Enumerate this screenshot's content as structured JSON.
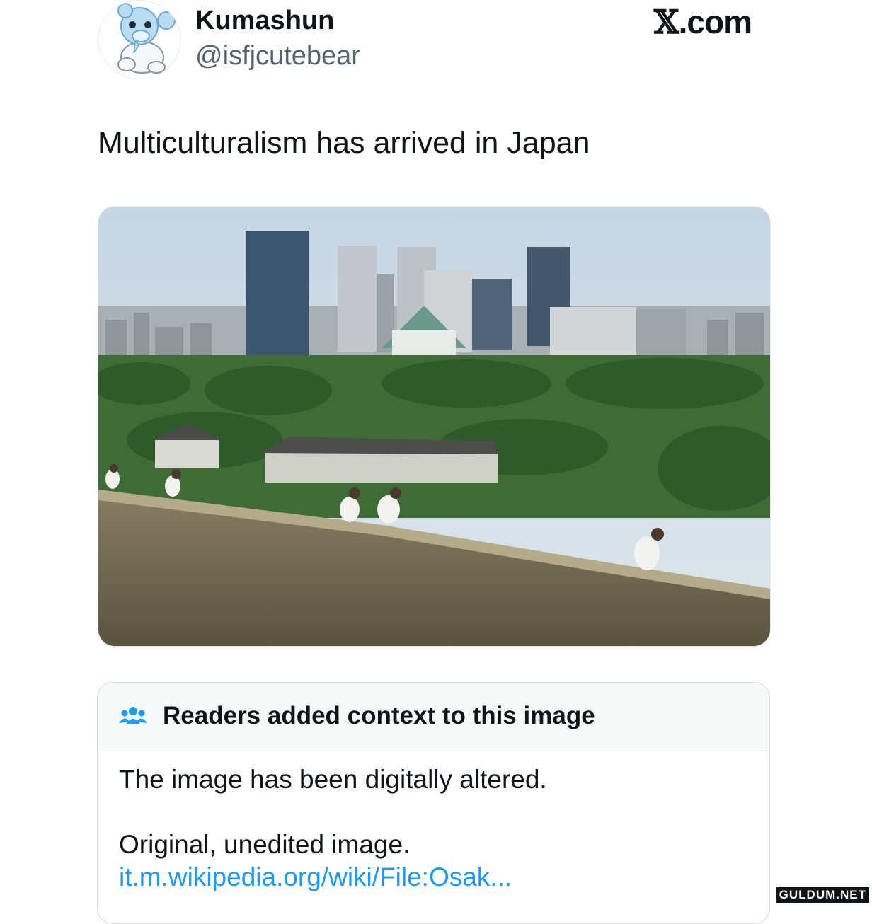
{
  "post": {
    "display_name": "Kumashun",
    "handle": "@isfjcutebear",
    "text": "Multiculturalism has arrived in Japan",
    "avatar_icon": "bear-plush-icon"
  },
  "brand": {
    "x_glyph": "𝕏",
    "suffix": ".com"
  },
  "media": {
    "description_icon": "photo-osaka-castle"
  },
  "community_note": {
    "icon": "people-group-icon",
    "title": "Readers added context to this image",
    "line1": "The image has been digitally altered.",
    "line2": "Original, unedited image.",
    "link": "it.m.wikipedia.org/wiki/File:Osak..."
  },
  "watermark": "GULDUM.NET",
  "colors": {
    "link": "#1d9bf0",
    "note_header_bg": "#f7f9f9",
    "handle": "#536471"
  }
}
